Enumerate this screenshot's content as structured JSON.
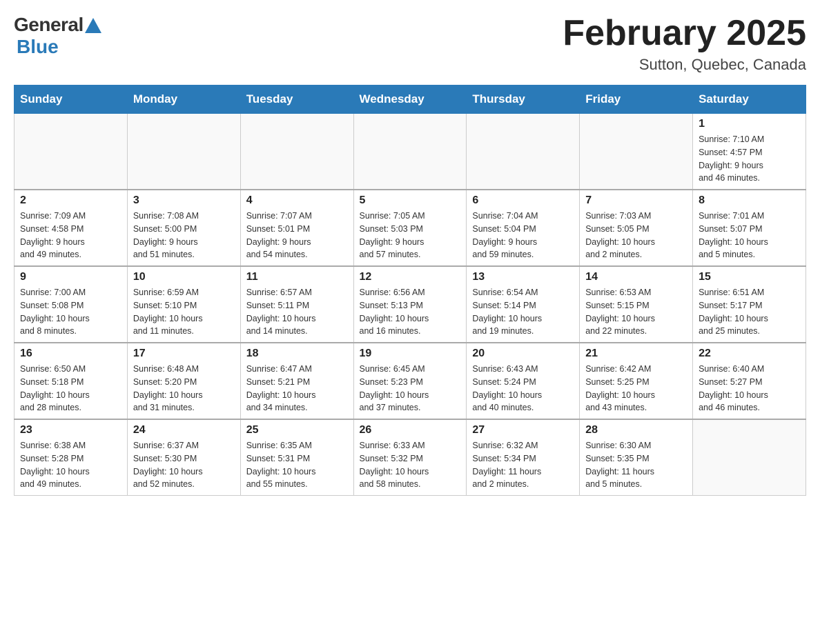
{
  "logo": {
    "general": "General",
    "blue": "Blue"
  },
  "title": "February 2025",
  "location": "Sutton, Quebec, Canada",
  "days_of_week": [
    "Sunday",
    "Monday",
    "Tuesday",
    "Wednesday",
    "Thursday",
    "Friday",
    "Saturday"
  ],
  "weeks": [
    [
      {
        "day": "",
        "info": ""
      },
      {
        "day": "",
        "info": ""
      },
      {
        "day": "",
        "info": ""
      },
      {
        "day": "",
        "info": ""
      },
      {
        "day": "",
        "info": ""
      },
      {
        "day": "",
        "info": ""
      },
      {
        "day": "1",
        "info": "Sunrise: 7:10 AM\nSunset: 4:57 PM\nDaylight: 9 hours\nand 46 minutes."
      }
    ],
    [
      {
        "day": "2",
        "info": "Sunrise: 7:09 AM\nSunset: 4:58 PM\nDaylight: 9 hours\nand 49 minutes."
      },
      {
        "day": "3",
        "info": "Sunrise: 7:08 AM\nSunset: 5:00 PM\nDaylight: 9 hours\nand 51 minutes."
      },
      {
        "day": "4",
        "info": "Sunrise: 7:07 AM\nSunset: 5:01 PM\nDaylight: 9 hours\nand 54 minutes."
      },
      {
        "day": "5",
        "info": "Sunrise: 7:05 AM\nSunset: 5:03 PM\nDaylight: 9 hours\nand 57 minutes."
      },
      {
        "day": "6",
        "info": "Sunrise: 7:04 AM\nSunset: 5:04 PM\nDaylight: 9 hours\nand 59 minutes."
      },
      {
        "day": "7",
        "info": "Sunrise: 7:03 AM\nSunset: 5:05 PM\nDaylight: 10 hours\nand 2 minutes."
      },
      {
        "day": "8",
        "info": "Sunrise: 7:01 AM\nSunset: 5:07 PM\nDaylight: 10 hours\nand 5 minutes."
      }
    ],
    [
      {
        "day": "9",
        "info": "Sunrise: 7:00 AM\nSunset: 5:08 PM\nDaylight: 10 hours\nand 8 minutes."
      },
      {
        "day": "10",
        "info": "Sunrise: 6:59 AM\nSunset: 5:10 PM\nDaylight: 10 hours\nand 11 minutes."
      },
      {
        "day": "11",
        "info": "Sunrise: 6:57 AM\nSunset: 5:11 PM\nDaylight: 10 hours\nand 14 minutes."
      },
      {
        "day": "12",
        "info": "Sunrise: 6:56 AM\nSunset: 5:13 PM\nDaylight: 10 hours\nand 16 minutes."
      },
      {
        "day": "13",
        "info": "Sunrise: 6:54 AM\nSunset: 5:14 PM\nDaylight: 10 hours\nand 19 minutes."
      },
      {
        "day": "14",
        "info": "Sunrise: 6:53 AM\nSunset: 5:15 PM\nDaylight: 10 hours\nand 22 minutes."
      },
      {
        "day": "15",
        "info": "Sunrise: 6:51 AM\nSunset: 5:17 PM\nDaylight: 10 hours\nand 25 minutes."
      }
    ],
    [
      {
        "day": "16",
        "info": "Sunrise: 6:50 AM\nSunset: 5:18 PM\nDaylight: 10 hours\nand 28 minutes."
      },
      {
        "day": "17",
        "info": "Sunrise: 6:48 AM\nSunset: 5:20 PM\nDaylight: 10 hours\nand 31 minutes."
      },
      {
        "day": "18",
        "info": "Sunrise: 6:47 AM\nSunset: 5:21 PM\nDaylight: 10 hours\nand 34 minutes."
      },
      {
        "day": "19",
        "info": "Sunrise: 6:45 AM\nSunset: 5:23 PM\nDaylight: 10 hours\nand 37 minutes."
      },
      {
        "day": "20",
        "info": "Sunrise: 6:43 AM\nSunset: 5:24 PM\nDaylight: 10 hours\nand 40 minutes."
      },
      {
        "day": "21",
        "info": "Sunrise: 6:42 AM\nSunset: 5:25 PM\nDaylight: 10 hours\nand 43 minutes."
      },
      {
        "day": "22",
        "info": "Sunrise: 6:40 AM\nSunset: 5:27 PM\nDaylight: 10 hours\nand 46 minutes."
      }
    ],
    [
      {
        "day": "23",
        "info": "Sunrise: 6:38 AM\nSunset: 5:28 PM\nDaylight: 10 hours\nand 49 minutes."
      },
      {
        "day": "24",
        "info": "Sunrise: 6:37 AM\nSunset: 5:30 PM\nDaylight: 10 hours\nand 52 minutes."
      },
      {
        "day": "25",
        "info": "Sunrise: 6:35 AM\nSunset: 5:31 PM\nDaylight: 10 hours\nand 55 minutes."
      },
      {
        "day": "26",
        "info": "Sunrise: 6:33 AM\nSunset: 5:32 PM\nDaylight: 10 hours\nand 58 minutes."
      },
      {
        "day": "27",
        "info": "Sunrise: 6:32 AM\nSunset: 5:34 PM\nDaylight: 11 hours\nand 2 minutes."
      },
      {
        "day": "28",
        "info": "Sunrise: 6:30 AM\nSunset: 5:35 PM\nDaylight: 11 hours\nand 5 minutes."
      },
      {
        "day": "",
        "info": ""
      }
    ]
  ]
}
